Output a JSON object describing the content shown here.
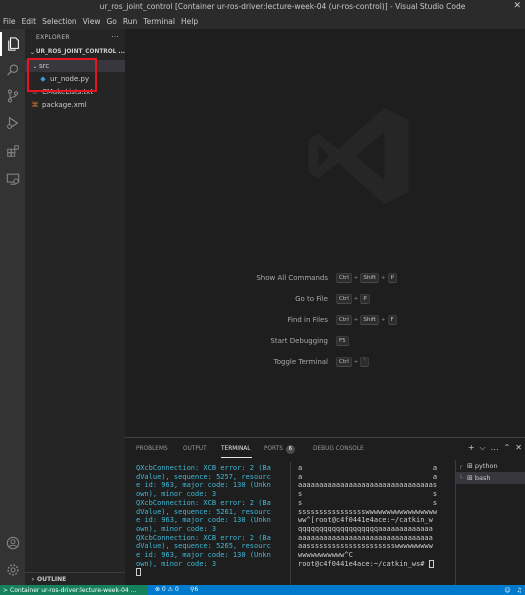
{
  "window": {
    "title": "ur_ros_joint_control [Container ur-ros-driver:lecture-week-04 (ur-ros-control)] - Visual Studio Code",
    "close_glyph": "✕"
  },
  "menu": [
    "File",
    "Edit",
    "Selection",
    "View",
    "Go",
    "Run",
    "Terminal",
    "Help"
  ],
  "activity_bar": {
    "items": [
      "explorer-icon",
      "search-icon",
      "source-control-icon",
      "run-debug-icon",
      "extensions-icon",
      "remote-explorer-icon"
    ],
    "bottom": [
      "account-icon",
      "settings-gear-icon"
    ]
  },
  "sidebar": {
    "header": "EXPLORER",
    "more": "···",
    "section": "UR_ROS_JOINT_CONTROL ...",
    "tree": [
      {
        "label": "src",
        "type": "folder",
        "expanded": true
      },
      {
        "label": "ur_node.py",
        "type": "python"
      },
      {
        "label": "CMakeLists.txt",
        "type": "cmake"
      },
      {
        "label": "package.xml",
        "type": "xml"
      }
    ],
    "outline": "OUTLINE",
    "highlight_color": "#e8141f"
  },
  "editor": {
    "shortcuts": [
      {
        "label": "Show All Commands",
        "keys": [
          "Ctrl",
          "Shift",
          "P"
        ]
      },
      {
        "label": "Go to File",
        "keys": [
          "Ctrl",
          "P"
        ]
      },
      {
        "label": "Find in Files",
        "keys": [
          "Ctrl",
          "Shift",
          "F"
        ]
      },
      {
        "label": "Start Debugging",
        "keys": [
          "F5"
        ]
      },
      {
        "label": "Toggle Terminal",
        "keys": [
          "Ctrl",
          "`"
        ]
      }
    ]
  },
  "panel": {
    "tabs": [
      {
        "label": "PROBLEMS"
      },
      {
        "label": "OUTPUT"
      },
      {
        "label": "TERMINAL",
        "active": true
      },
      {
        "label": "PORTS",
        "badge": "6"
      },
      {
        "label": "DEBUG CONSOLE"
      }
    ],
    "actions": [
      "+",
      "⌵",
      "…",
      "⌃",
      "✕"
    ],
    "terminal_left": "QXcbConnection: XCB error: 2 (Ba\ndValue), sequence: 5257, resourc\ne id: 963, major code: 130 (Unkn\nown), minor code: 3\nQXcbConnection: XCB error: 2 (Ba\ndValue), sequence: 5261, resourc\ne id: 963, major code: 130 (Unkn\nown), minor code: 3\nQXcbConnection: XCB error: 2 (Ba\ndValue), sequence: 5265, resourc\ne id: 963, major code: 130 (Unkn\nown), minor code: 3",
    "terminal_right": "a                               a\na                               a\naaaaaaaaaaaaaaaaaaaaaaaaaaaaaaaas\ns                               s\ns                               s\nsssssssssssssssswwwwwwwwwwwwwwwww\nww^[root@c4f0441e4ace:~/catkin_w\nqqqqqqqqqqqqqqqqqqqaaaaaaaaaaaaa\naaaaaaaaaaaaaaaaaaaaaaaaaaaaaaaa\naassssssssssssssssssssswwwwwwwww\nwwwwwwwwwww^C\nroot@c4f0441e4ace:~/catkin_ws# ",
    "terminals": [
      {
        "label": "python"
      },
      {
        "label": "bash",
        "selected": true
      }
    ]
  },
  "statusbar": {
    "remote": "Container ur-ros-driver:lecture-week-04 ...",
    "problems": "⊗ 0 ⚠ 0",
    "ports": "6",
    "color_remote": "#16825d",
    "color_bar": "#007acc"
  }
}
